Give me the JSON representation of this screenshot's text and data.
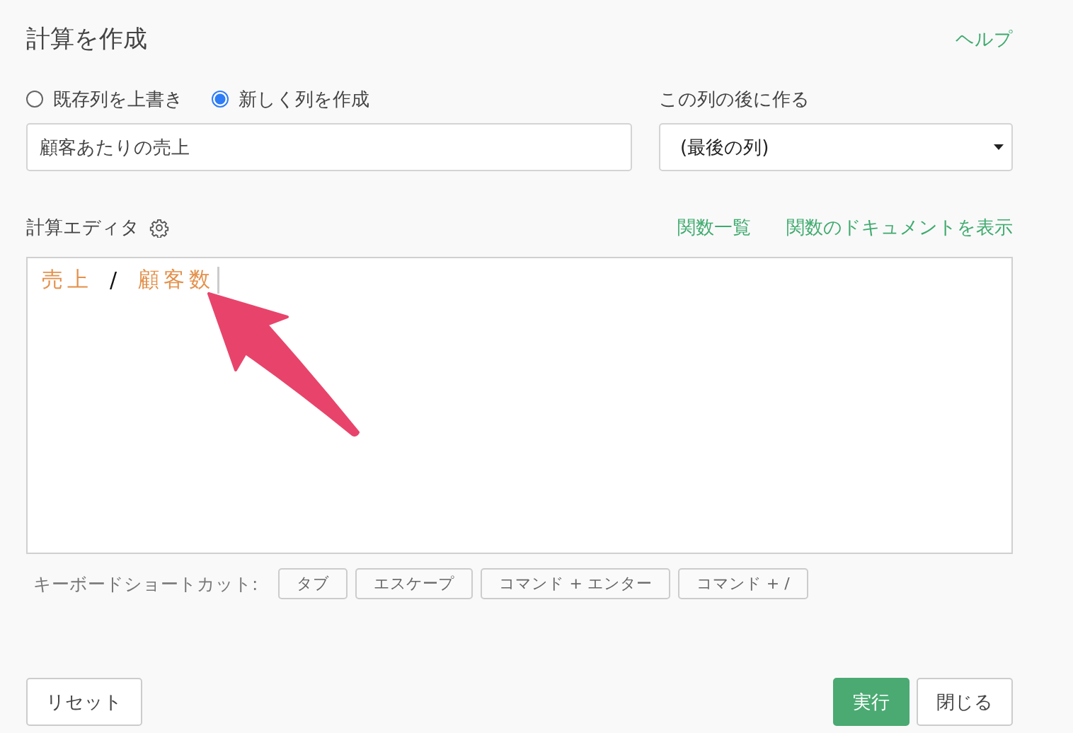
{
  "title": "計算を作成",
  "help_link": "ヘルプ",
  "mode_options": [
    {
      "label": "既存列を上書き",
      "selected": false
    },
    {
      "label": "新しく列を作成",
      "selected": true
    }
  ],
  "column_name": {
    "value": "顧客あたりの売上"
  },
  "insert_after": {
    "label": "この列の後に作る",
    "value": "(最後の列)"
  },
  "editor": {
    "label": "計算エディタ",
    "links": [
      "関数一覧",
      "関数のドキュメントを表示"
    ],
    "tokens": [
      {
        "kind": "column",
        "text": "売上"
      },
      {
        "kind": "operator",
        "text": "/"
      },
      {
        "kind": "column",
        "text": "顧客数"
      }
    ]
  },
  "shortcuts": {
    "label": "キーボードショートカット:",
    "keys": [
      "タブ",
      "エスケープ",
      "コマンド + エンター",
      "コマンド + /"
    ]
  },
  "buttons": {
    "reset": "リセット",
    "run": "実行",
    "close": "閉じる"
  }
}
